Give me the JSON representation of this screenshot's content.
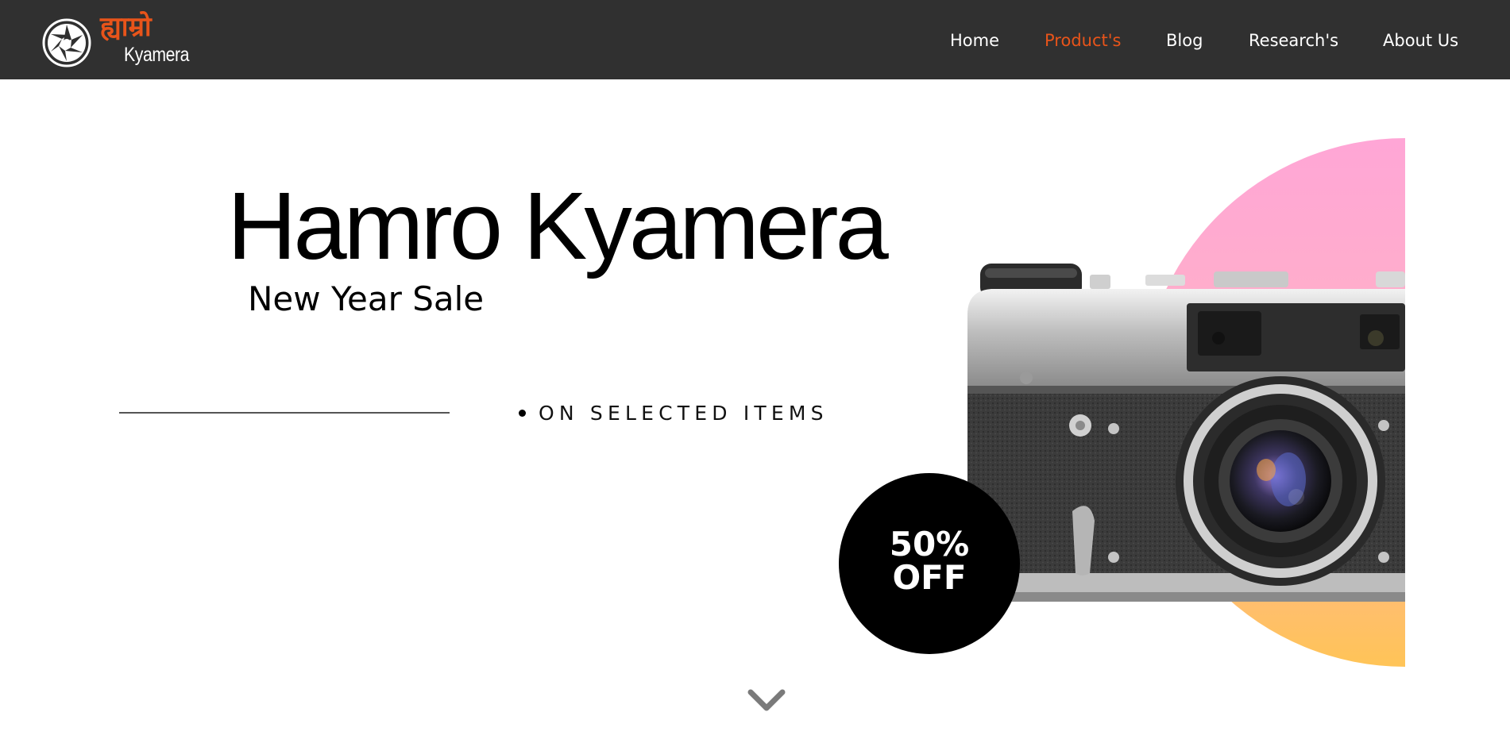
{
  "header": {
    "logo": {
      "devanagari": "ह्याम्रो",
      "wordmark": "Kyamera",
      "icon": "camera-aperture-icon",
      "accent_color": "#e8541a"
    },
    "nav": [
      {
        "label": "Home",
        "active": false
      },
      {
        "label": "Product's",
        "active": true
      },
      {
        "label": "Blog",
        "active": false
      },
      {
        "label": "Research's",
        "active": false
      },
      {
        "label": "About Us",
        "active": false
      }
    ],
    "background_color": "#303030"
  },
  "hero": {
    "title": "Hamro Kyamera",
    "subtitle": "New Year Sale",
    "tagline": "ON SELECTED ITEMS",
    "badge": {
      "line1": "50%",
      "line2": "OFF"
    },
    "image": "vintage-rangefinder-camera",
    "gradient_colors": [
      "#ffa6d6",
      "#ffc457"
    ]
  },
  "scroll_indicator": {
    "icon": "chevron-down-icon"
  }
}
